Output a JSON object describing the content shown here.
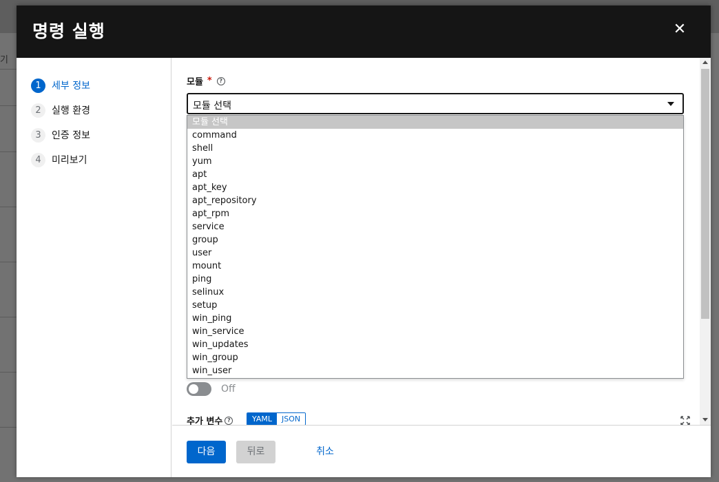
{
  "background": {
    "fragment": "기"
  },
  "modal": {
    "title": "명령 실행",
    "close_icon": "close-icon"
  },
  "wizard": {
    "steps": [
      {
        "number": "1",
        "label": "세부 정보",
        "active": true
      },
      {
        "number": "2",
        "label": "실행 환경",
        "active": false
      },
      {
        "number": "3",
        "label": "인증 정보",
        "active": false
      },
      {
        "number": "4",
        "label": "미리보기",
        "active": false
      }
    ]
  },
  "form": {
    "module_label": "모듈",
    "required_marker": "*",
    "help_icon": "?",
    "module_select": {
      "value": "모듈 선택",
      "options": [
        "모듈 선택",
        "command",
        "shell",
        "yum",
        "apt",
        "apt_key",
        "apt_repository",
        "apt_rpm",
        "service",
        "group",
        "user",
        "mount",
        "ping",
        "selinux",
        "setup",
        "win_ping",
        "win_service",
        "win_updates",
        "win_group",
        "win_user"
      ]
    },
    "toggle_label": "Off",
    "extra_vars_label": "추가 변수",
    "format_yaml": "YAML",
    "format_json": "JSON"
  },
  "footer": {
    "next_label": "다음",
    "back_label": "뒤로",
    "cancel_label": "취소"
  },
  "colors": {
    "header_bg": "#151515",
    "primary": "#0066cc",
    "required": "#c9190b"
  }
}
